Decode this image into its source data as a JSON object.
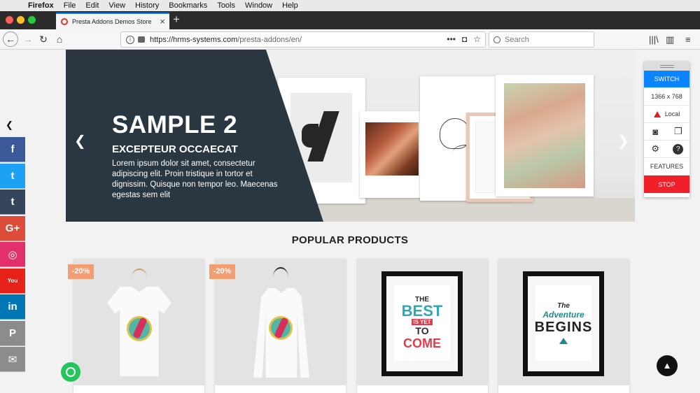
{
  "os_menu": {
    "app": "Firefox",
    "items": [
      "File",
      "Edit",
      "View",
      "History",
      "Bookmarks",
      "Tools",
      "Window",
      "Help"
    ]
  },
  "browser": {
    "tab_title": "Presta Addons Demos Store",
    "url_host": "https://hrms-systems.com",
    "url_path": "/presta-addons/en/",
    "search_placeholder": "Search",
    "more_icon": "•••"
  },
  "hero": {
    "title": "SAMPLE 2",
    "subtitle": "EXCEPTEUR OCCAECAT",
    "text": "Lorem ipsum dolor sit amet, consectetur adipiscing elit. Proin tristique in tortor et dignissim. Quisque non tempor leo. Maecenas egestas sem elit"
  },
  "social_bar": [
    {
      "name": "facebook",
      "glyph": "f",
      "color": "#3b5998"
    },
    {
      "name": "twitter",
      "glyph": "t",
      "color": "#1da1f2"
    },
    {
      "name": "tumblr",
      "glyph": "t",
      "color": "#35465c"
    },
    {
      "name": "google-plus",
      "glyph": "G+",
      "color": "#dd4b39"
    },
    {
      "name": "instagram",
      "glyph": "◎",
      "color": "#e1306c"
    },
    {
      "name": "youtube",
      "glyph": "You",
      "color": "#e62117"
    },
    {
      "name": "linkedin",
      "glyph": "in",
      "color": "#0077b5"
    },
    {
      "name": "pinterest",
      "glyph": "P",
      "color": "#8c8c8c"
    },
    {
      "name": "email",
      "glyph": "✉",
      "color": "#8c8c8c"
    }
  ],
  "right_panel": {
    "switch_label": "SWITCH",
    "resolution": "1366 x 768",
    "env_label": "Local",
    "features_label": "FEATURES",
    "stop_label": "STOP"
  },
  "products": {
    "title": "POPULAR PRODUCTS",
    "items": [
      {
        "badge": "-20%"
      },
      {
        "badge": "-20%"
      },
      {
        "poster_lines": [
          "THE",
          "BEST",
          "IS YET",
          "TO",
          "COME"
        ]
      },
      {
        "poster_lines": [
          "The",
          "Adventure",
          "BEGINS"
        ]
      }
    ]
  },
  "colors": {
    "accent_blue": "#0a84ff",
    "stop_red": "#f01f2a",
    "hero_dark": "#2a3640",
    "badge": "#f39d72"
  }
}
